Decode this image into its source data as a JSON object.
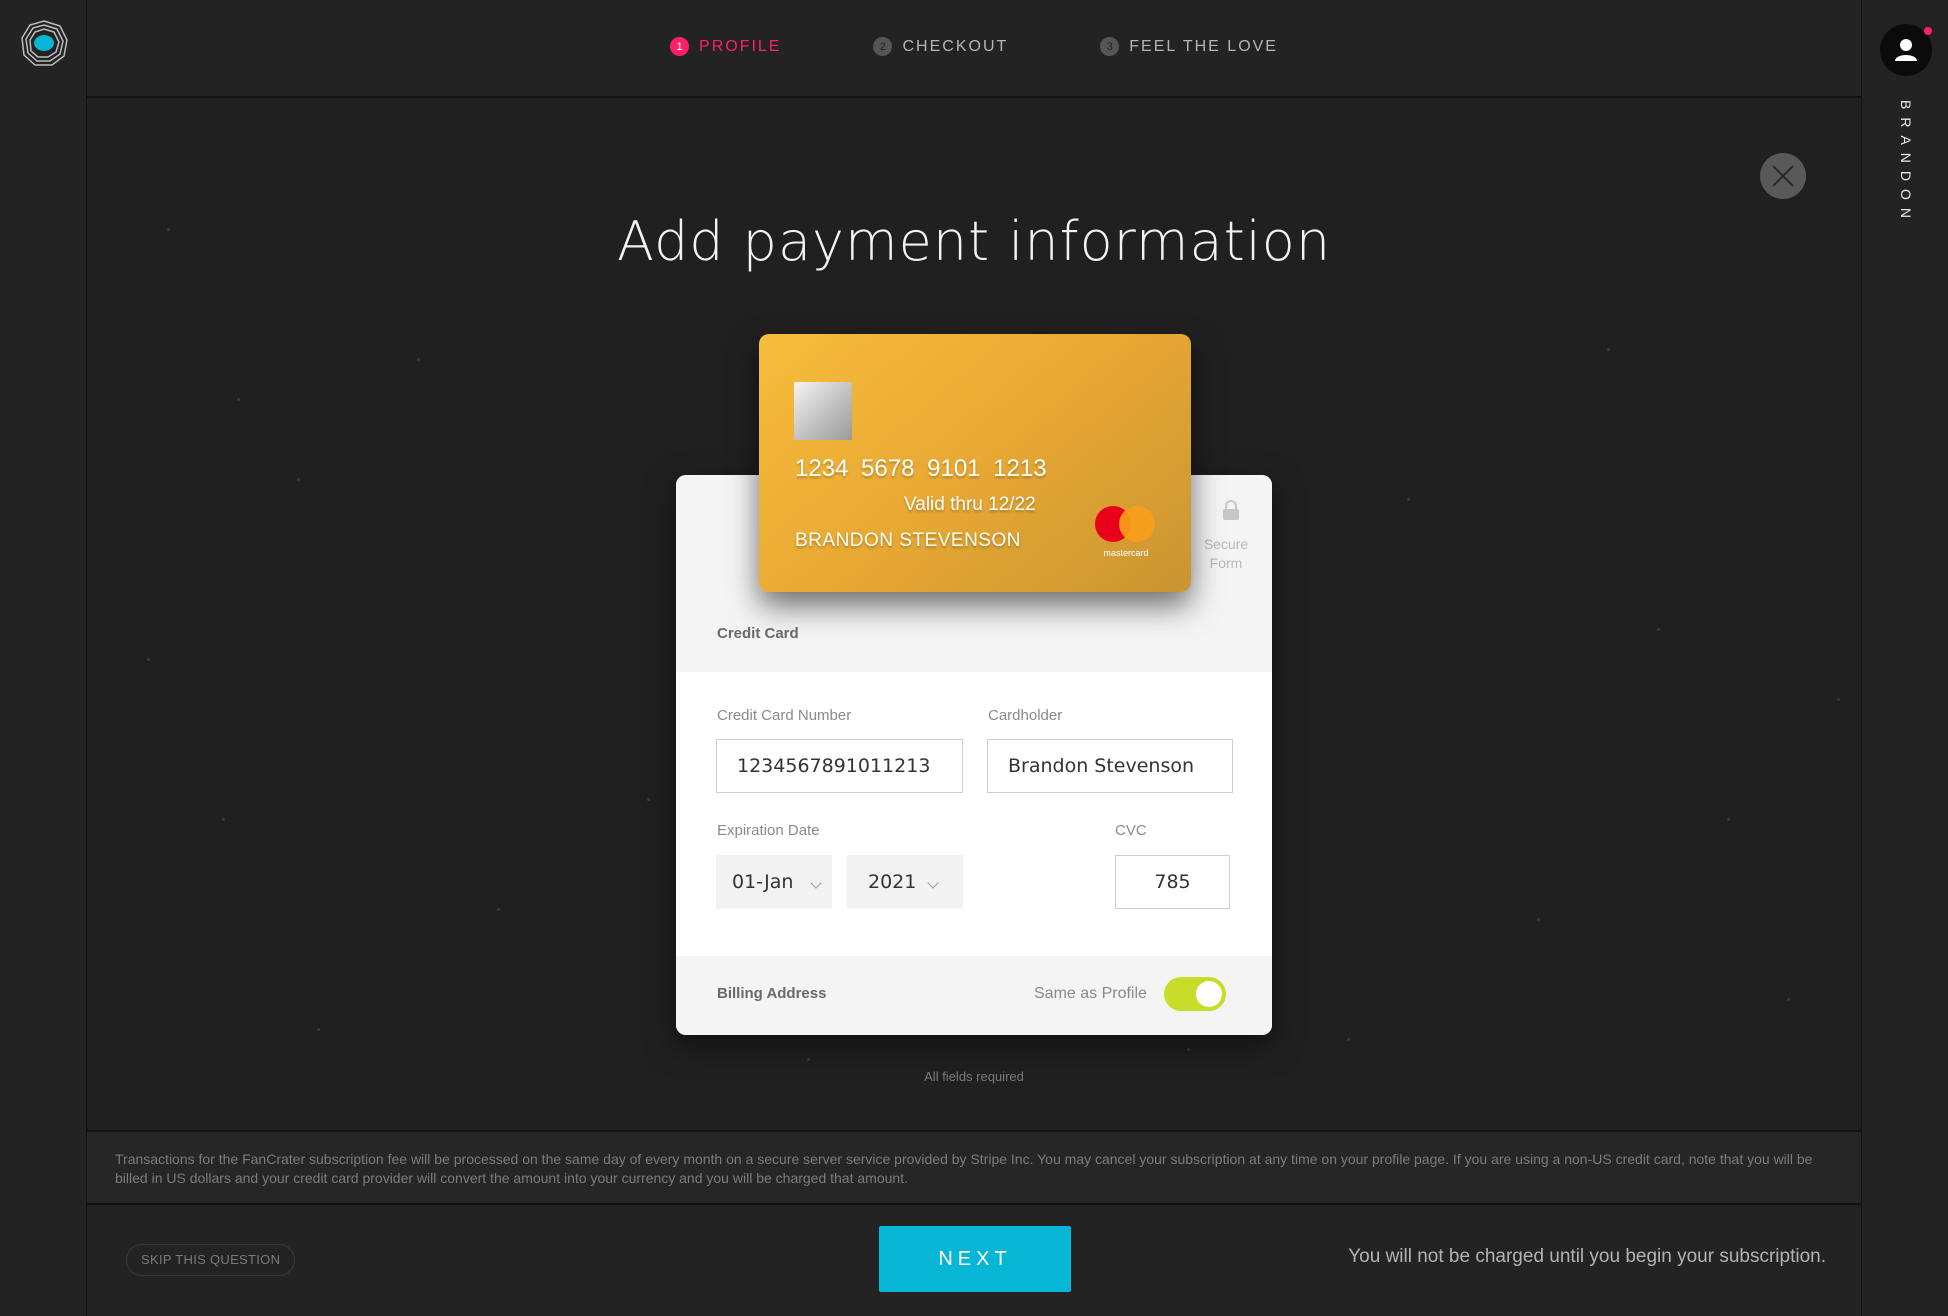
{
  "app": {
    "user_name": "BRANDON"
  },
  "steps": [
    {
      "num": "1",
      "label": "PROFILE"
    },
    {
      "num": "2",
      "label": "CHECKOUT"
    },
    {
      "num": "3",
      "label": "FEEL THE LOVE"
    }
  ],
  "page": {
    "title": "Add payment information"
  },
  "card_preview": {
    "number": "1234 5678 9101 1213",
    "valid": "Valid thru 12/22",
    "holder": "BRANDON STEVENSON",
    "brand": "mastercard"
  },
  "form": {
    "secure_label": "Secure Form",
    "section_title": "Credit Card",
    "card_number_label": "Credit Card Number",
    "card_number_value": "1234567891011213",
    "cardholder_label": "Cardholder",
    "cardholder_value": "Brandon Stevenson",
    "expiration_label": "Expiration Date",
    "exp_month_value": "01-Jan",
    "exp_year_value": "2021",
    "cvc_label": "CVC",
    "cvc_value": "785",
    "billing_label": "Billing Address",
    "same_as_profile_label": "Same as Profile",
    "same_as_profile_on": true
  },
  "required_note": "All fields required",
  "disclaimer": "Transactions for the FanCrater subscription fee will be processed on the same day of every month on a secure server service provided by Stripe Inc. You may cancel your subscription at any time on your profile page. If you are using a non-US credit card, note that you will be billed in US dollars and your credit card provider will convert the amount into your currency and you will be charged that amount.",
  "footer": {
    "skip_label": "SKIP THIS QUESTION",
    "next_label": "NEXT",
    "charge_note": "You will not be charged until you begin your subscription."
  },
  "colors": {
    "accent_pink": "#ff1f6b",
    "accent_cyan": "#06b6d4",
    "toggle_green": "#c8dc2a"
  }
}
